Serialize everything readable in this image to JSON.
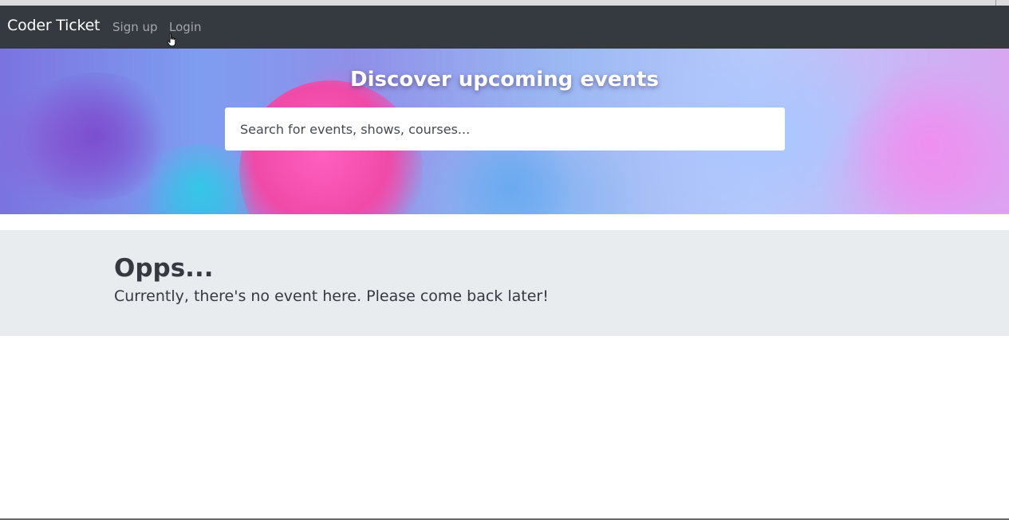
{
  "navbar": {
    "brand": "Coder Ticket",
    "links": [
      {
        "label": "Sign up"
      },
      {
        "label": "Login"
      }
    ],
    "background": "#343a40"
  },
  "hero": {
    "title": "Discover upcoming events",
    "search": {
      "value": "",
      "placeholder": "Search for events, shows, courses..."
    }
  },
  "empty_state": {
    "title": "Opps...",
    "message": "Currently, there's no event here. Please come back later!"
  },
  "colors": {
    "accent_pink": "#ff4fb8",
    "panel_bg": "#e9ecef",
    "text_dark": "#343a40"
  },
  "icons": {
    "cursor": "hand-pointer-icon"
  }
}
